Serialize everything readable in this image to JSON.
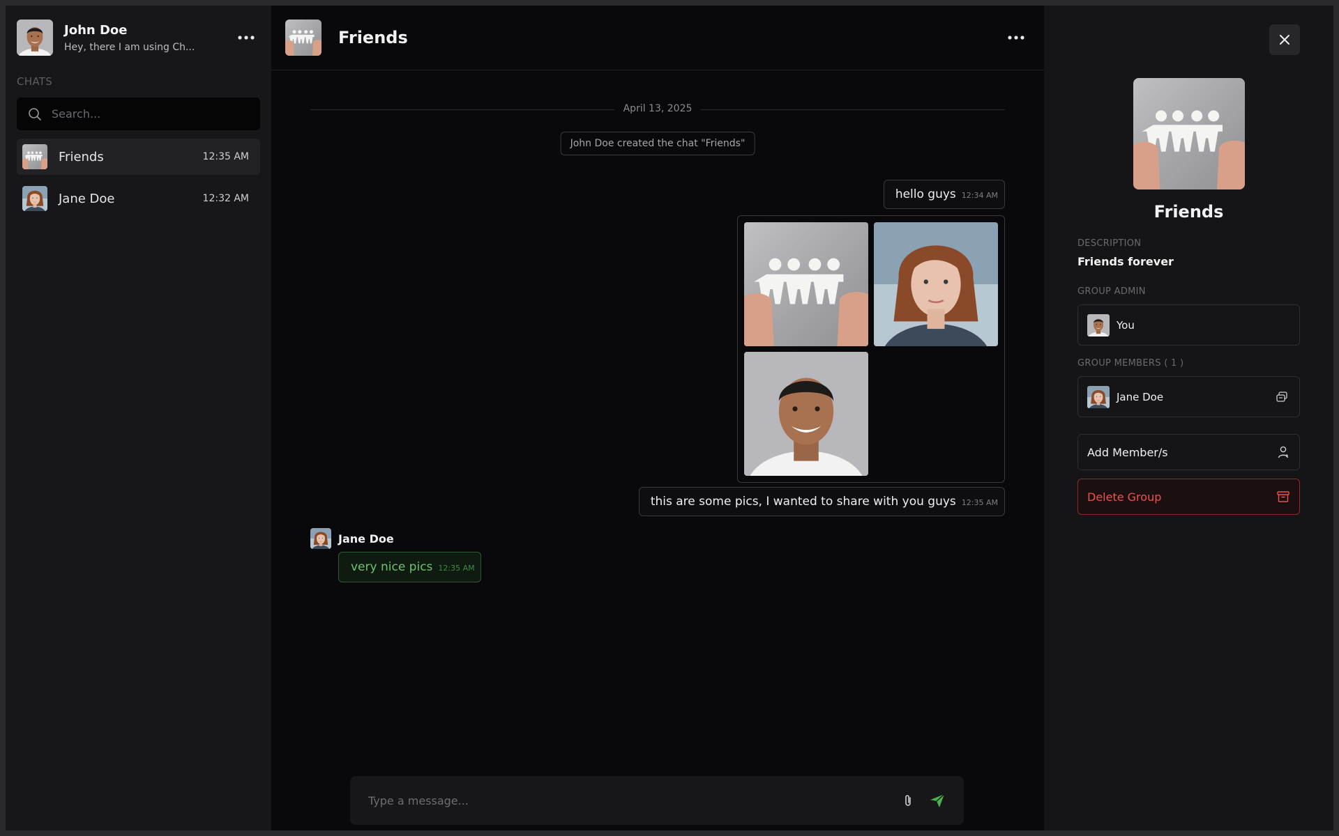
{
  "sidebar": {
    "profile": {
      "name": "John Doe",
      "status": "Hey, there I am using Ch..."
    },
    "section_label": "CHATS",
    "search": {
      "placeholder": "Search...",
      "value": ""
    },
    "chats": [
      {
        "name": "Friends",
        "time": "12:35 AM",
        "active": true
      },
      {
        "name": "Jane Doe",
        "time": "12:32 AM",
        "active": false
      }
    ]
  },
  "header": {
    "title": "Friends"
  },
  "messages": {
    "date": "April 13, 2025",
    "system": "John Doe created the chat \"Friends\"",
    "out1": {
      "text": "hello guys",
      "time": "12:34 AM"
    },
    "out2": {
      "text": "this are some pics, I wanted to share with you guys",
      "time": "12:35 AM"
    },
    "incoming": {
      "sender": "Jane Doe",
      "text": "very nice pics",
      "time": "12:35 AM"
    }
  },
  "composer": {
    "placeholder": "Type a message..."
  },
  "details": {
    "name": "Friends",
    "description_label": "DESCRIPTION",
    "description": "Friends forever",
    "admin_label": "GROUP ADMIN",
    "admin_name": "You",
    "members_label": "GROUP MEMBERS ( 1 )",
    "members": [
      {
        "name": "Jane Doe"
      }
    ],
    "add_member": "Add Member/s",
    "delete_group": "Delete Group"
  },
  "colors": {
    "accent_green": "#4caf50",
    "danger_red": "#f05151",
    "background": "#09090b"
  }
}
